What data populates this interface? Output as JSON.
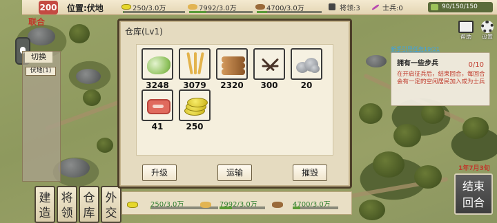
{
  "top_bar": {
    "level_badge": "200",
    "location": "位置:伏地",
    "resources": [
      {
        "icon": "coin-icon",
        "text": "250/3.0万",
        "fill": 0.01
      },
      {
        "icon": "wheat-icon",
        "text": "7992/3.0万",
        "fill": 0.27
      },
      {
        "icon": "wood-icon",
        "text": "4700/3.0万",
        "fill": 0.16
      }
    ],
    "generals": "将领:3",
    "soldiers": "士兵:0",
    "hp": "90/150/150",
    "colors": {
      "accent_red": "#c0392b",
      "bar_green": "#5b9a3a"
    }
  },
  "left_panel": {
    "union_label": "联合",
    "switch_tab": "切换",
    "territory_button": "伏地(1)"
  },
  "action_buttons": [
    {
      "line1": "建",
      "line2": "造"
    },
    {
      "line1": "将",
      "line2": "领"
    },
    {
      "line1": "仓",
      "line2": "库"
    },
    {
      "line1": "外",
      "line2": "交"
    }
  ],
  "right_panel": {
    "help_label": "帮助",
    "settings_label": "设置",
    "quest_header": "新手引导任务19/21",
    "quest_name": "拥有一些步兵",
    "quest_progress": "0/10",
    "quest_desc": "在开启征兵后，结束回合，每回合会有一定的空闲居民加入成为士兵",
    "date": "1年7月3旬",
    "end_turn_line1": "结束",
    "end_turn_line2": "回合"
  },
  "dialog": {
    "title": "仓库(Lv1)",
    "items": [
      {
        "name": "cabbage-icon",
        "count": "3248"
      },
      {
        "name": "wheat-icon",
        "count": "3079"
      },
      {
        "name": "wood-icon",
        "count": "2320"
      },
      {
        "name": "iron-icon",
        "count": "300"
      },
      {
        "name": "stone-icon",
        "count": "20"
      },
      {
        "name": "meat-icon",
        "count": "41"
      },
      {
        "name": "coin-icon",
        "count": "250"
      }
    ],
    "buttons": {
      "upgrade": "升级",
      "transport": "运输",
      "destroy": "摧毁"
    }
  },
  "bottom_bar": {
    "resources": [
      {
        "icon": "coin-icon",
        "text": "250/3.0万",
        "fill": 0.01
      },
      {
        "icon": "wheat-icon",
        "text": "7992/3.0万",
        "fill": 0.27
      },
      {
        "icon": "wood-icon",
        "text": "4700/3.0万",
        "fill": 0.16
      }
    ]
  }
}
